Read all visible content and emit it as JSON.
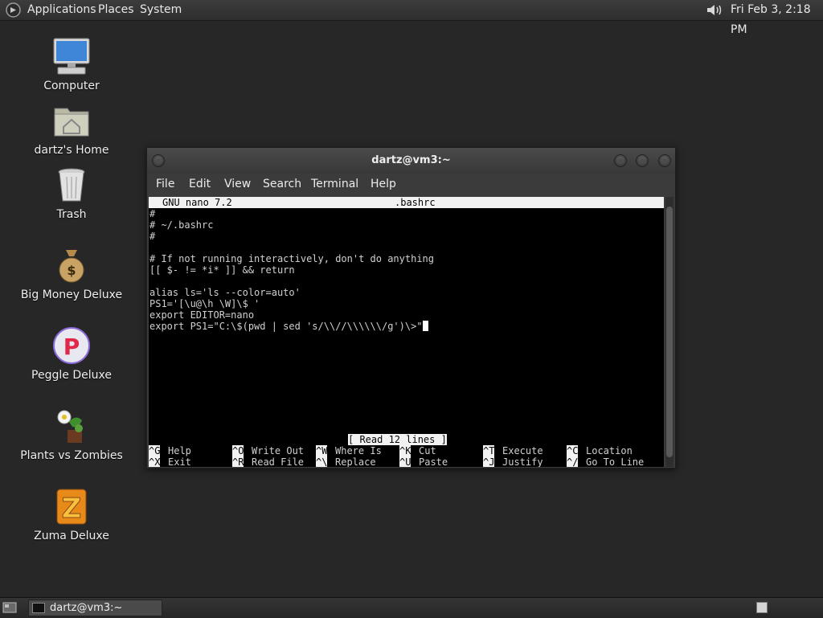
{
  "top_panel": {
    "menus": {
      "applications": "Applications",
      "places": "Places",
      "system": "System"
    },
    "clock": "Fri Feb  3,  2:18 PM",
    "icons": {
      "logo": "gnome-foot-icon",
      "volume": "speaker-icon"
    }
  },
  "desktop": {
    "icons": [
      {
        "label": "Computer",
        "icon": "computer-icon"
      },
      {
        "label": "dartz's Home",
        "icon": "home-folder-icon"
      },
      {
        "label": "Trash",
        "icon": "trash-icon"
      },
      {
        "label": "Big Money Deluxe",
        "icon": "money-bag-icon"
      },
      {
        "label": "Peggle Deluxe",
        "icon": "peggle-icon"
      },
      {
        "label": "Plants vs Zombies",
        "icon": "plants-vs-zombies-icon"
      },
      {
        "label": "Zuma Deluxe",
        "icon": "zuma-icon"
      }
    ]
  },
  "terminal": {
    "title": "dartz@vm3:~",
    "menu": [
      "File",
      "Edit",
      "View",
      "Search",
      "Terminal",
      "Help"
    ],
    "nano": {
      "version": "GNU nano 7.2",
      "filename": ".bashrc",
      "lines": [
        "#",
        "# ~/.bashrc",
        "#",
        "",
        "# If not running interactively, don't do anything",
        "[[ $- != *i* ]] && return",
        "",
        "alias ls='ls --color=auto'",
        "PS1='[\\u@\\h \\W]\\$ '",
        "export EDITOR=nano",
        "export PS1=\"C:\\$(pwd | sed 's/\\\\//\\\\\\\\\\\\/g')\\>\""
      ],
      "status": "[ Read 12 lines ]",
      "shortcuts": [
        [
          {
            "key": "^G",
            "label": "Help"
          },
          {
            "key": "^O",
            "label": "Write Out"
          },
          {
            "key": "^W",
            "label": "Where Is"
          },
          {
            "key": "^K",
            "label": "Cut"
          },
          {
            "key": "^T",
            "label": "Execute"
          },
          {
            "key": "^C",
            "label": "Location"
          }
        ],
        [
          {
            "key": "^X",
            "label": "Exit"
          },
          {
            "key": "^R",
            "label": "Read File"
          },
          {
            "key": "^\\",
            "label": "Replace"
          },
          {
            "key": "^U",
            "label": "Paste"
          },
          {
            "key": "^J",
            "label": "Justify"
          },
          {
            "key": "^/",
            "label": "Go To Line"
          }
        ]
      ]
    }
  },
  "bottom_panel": {
    "task_label": "dartz@vm3:~",
    "icons": {
      "show_desktop": "show-desktop-icon",
      "task": "terminal-icon",
      "workspace": "workspace-switcher-icon"
    }
  }
}
